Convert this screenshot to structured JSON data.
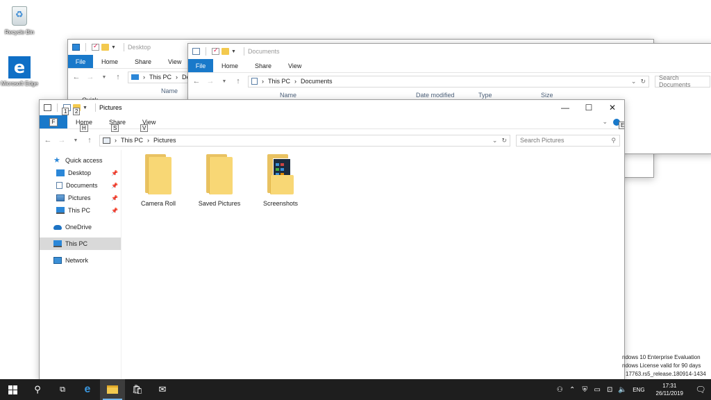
{
  "desktop": {
    "icons": [
      {
        "label": "Recycle Bin"
      },
      {
        "label": "Microsoft Edge"
      }
    ]
  },
  "win_desktop": {
    "title": "Desktop",
    "tabs": [
      "File",
      "Home",
      "Share",
      "View"
    ],
    "breadcrumb": [
      "This PC",
      "Desktop"
    ],
    "column_name": "Name",
    "sidebar_partial": "Quick"
  },
  "win_documents": {
    "title": "Documents",
    "tabs": [
      "File",
      "Home",
      "Share",
      "View"
    ],
    "breadcrumb": [
      "This PC",
      "Documents"
    ],
    "search_placeholder": "Search Documents",
    "columns": [
      "Name",
      "Date modified",
      "Type",
      "Size"
    ]
  },
  "win_pictures": {
    "title": "Pictures",
    "tabs": [
      "File",
      "Home",
      "Share",
      "View"
    ],
    "keytips": {
      "qa1": "1",
      "qa2": "2",
      "file": "F",
      "home": "H",
      "share": "S",
      "view": "V",
      "help": "E"
    },
    "breadcrumb": [
      "This PC",
      "Pictures"
    ],
    "search_placeholder": "Search Pictures",
    "sidebar": [
      {
        "label": "Quick access",
        "icon": "star-icon",
        "pinned": false,
        "selected": false
      },
      {
        "label": "Desktop",
        "icon": "desktop-icon",
        "pinned": true,
        "selected": false
      },
      {
        "label": "Documents",
        "icon": "documents-icon",
        "pinned": true,
        "selected": false
      },
      {
        "label": "Pictures",
        "icon": "pictures-icon",
        "pinned": true,
        "selected": false
      },
      {
        "label": "This PC",
        "icon": "this-pc-icon",
        "pinned": true,
        "selected": false
      },
      {
        "label": "OneDrive",
        "icon": "onedrive-icon",
        "pinned": false,
        "selected": false
      },
      {
        "label": "This PC",
        "icon": "this-pc-icon",
        "pinned": false,
        "selected": true
      },
      {
        "label": "Network",
        "icon": "network-icon",
        "pinned": false,
        "selected": false
      }
    ],
    "folders": [
      {
        "label": "Camera Roll",
        "icon": "folder-icon"
      },
      {
        "label": "Saved Pictures",
        "icon": "folder-icon"
      },
      {
        "label": "Screenshots",
        "icon": "folder-with-thumbnail-icon"
      }
    ]
  },
  "watermark": {
    "line1": "ndows 10 Enterprise Evaluation",
    "line2": "ndows License valid for 90 days",
    "line3": "17763.rs5_release.180914-1434"
  },
  "taskbar": {
    "apps": [
      "start-icon",
      "search-icon",
      "task-view-icon",
      "edge-icon",
      "file-explorer-icon",
      "store-icon",
      "mail-icon"
    ],
    "active_app": "file-explorer-icon",
    "language": "ENG",
    "time": "17:31",
    "date": "26/11/2019"
  }
}
